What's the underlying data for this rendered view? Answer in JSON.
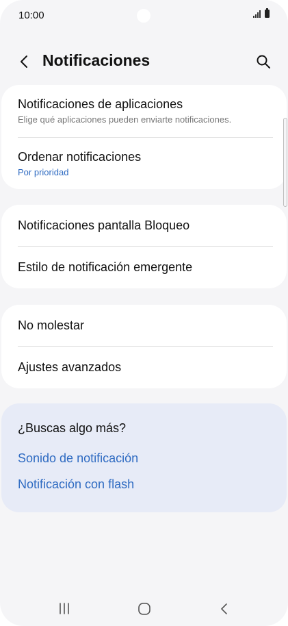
{
  "status_bar": {
    "time": "10:00"
  },
  "header": {
    "title": "Notificaciones",
    "back_icon": "chevron-left-icon",
    "search_icon": "search-icon"
  },
  "card1": {
    "items": [
      {
        "title": "Notificaciones de aplicaciones",
        "subtitle": "Elige qué aplicaciones pueden enviarte notificaciones."
      },
      {
        "title": "Ordenar notificaciones",
        "subtitle": "Por prioridad"
      }
    ]
  },
  "card2": {
    "items": [
      {
        "title": "Notificaciones pantalla Bloqueo"
      },
      {
        "title": "Estilo de notificación emergente"
      }
    ]
  },
  "card3": {
    "items": [
      {
        "title": "No molestar"
      },
      {
        "title": "Ajustes avanzados"
      }
    ]
  },
  "suggestions": {
    "title": "¿Buscas algo más?",
    "links": [
      "Sonido de notificación",
      "Notificación con flash"
    ]
  },
  "colors": {
    "accent": "#2f6bc2",
    "background": "#f5f5f7",
    "card": "#ffffff",
    "suggestions_bg": "#e7ebf7"
  },
  "navbar": {
    "icons": [
      "recents-icon",
      "home-icon",
      "back-icon"
    ]
  }
}
